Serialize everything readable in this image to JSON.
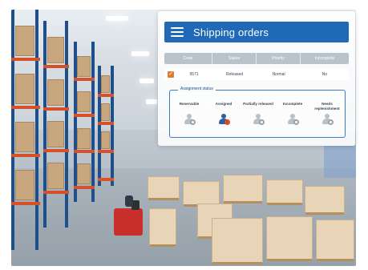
{
  "window": {
    "title": "Shipping orders"
  },
  "table": {
    "columns": [
      "Code",
      "Status",
      "Priority",
      "Incomplete"
    ],
    "rows": [
      {
        "checked": true,
        "code": "9571",
        "status": "Released",
        "priority": "Normal",
        "incomplete": "No"
      }
    ]
  },
  "assignment": {
    "legend": "Assignment status",
    "items": [
      {
        "label": "Reservable",
        "active": false
      },
      {
        "label": "Assigned",
        "active": true
      },
      {
        "label": "Partially released",
        "active": false
      },
      {
        "label": "Incomplete",
        "active": false
      },
      {
        "label": "Needs replenishment",
        "active": false
      }
    ]
  },
  "colors": {
    "header": "#1f69b6",
    "active_status": "#d9482b",
    "checkbox": "#e07b2e"
  },
  "icons": {
    "menu": "hamburger-menu-icon",
    "status": "person-gear-icon"
  }
}
